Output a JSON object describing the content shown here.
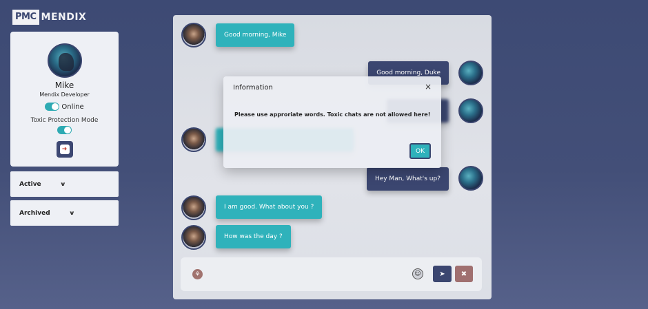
{
  "logo": {
    "pmc": "PMC",
    "mendix": "MENDIX"
  },
  "profile": {
    "name": "Mike",
    "role": "Mendix Developer",
    "status_label": "Online",
    "toxic_label": "Toxic Protection Mode",
    "status_on": true,
    "toxic_on": true,
    "logout_icon": "logout-arrow-icon"
  },
  "sidebar": {
    "sections": [
      {
        "label": "Active",
        "chevron": "∨"
      },
      {
        "label": "Archived",
        "chevron": "∨"
      }
    ]
  },
  "chat": {
    "messages": [
      {
        "from": "Mike",
        "direction": "incoming",
        "text": "Good morning, Mike"
      },
      {
        "from": "Duke",
        "direction": "outgoing",
        "text": "Good morning, Duke"
      },
      {
        "from": "Duke",
        "direction": "outgoing",
        "text": ""
      },
      {
        "from": "Mike",
        "direction": "incoming",
        "text": ""
      },
      {
        "from": "Duke",
        "direction": "outgoing",
        "text": "Hey Man, What's up?"
      },
      {
        "from": "Mike",
        "direction": "incoming",
        "text": "I am good. What about you ?"
      },
      {
        "from": "Mike",
        "direction": "incoming",
        "text": "How was the day ?"
      }
    ]
  },
  "modal": {
    "title": "Information",
    "close": "×",
    "body": "Please use approriate words. Toxic chats are not allowed here!",
    "ok_label": "OK"
  },
  "composer": {
    "placeholder": "",
    "attach_glyph": "⚘",
    "emoji_glyph": "☺",
    "send_glyph": "➤",
    "delete_glyph": "✖"
  },
  "colors": {
    "accent_teal": "#2fb2bb",
    "navy": "#3b4670",
    "delete": "#a07070"
  }
}
